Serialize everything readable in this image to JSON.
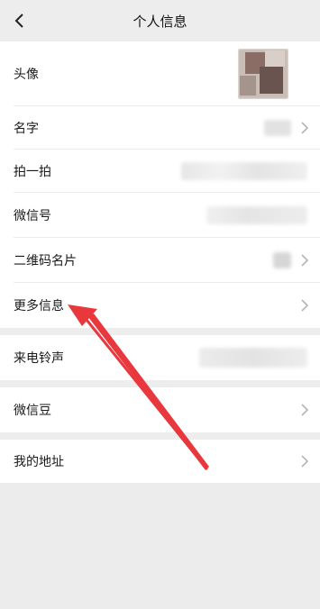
{
  "header": {
    "title": "个人信息",
    "back_icon": "chevron-left-icon"
  },
  "profile_rows": [
    {
      "label": "头像"
    },
    {
      "label": "名字"
    },
    {
      "label": "拍一拍"
    },
    {
      "label": "微信号"
    },
    {
      "label": "二维码名片"
    },
    {
      "label": "更多信息"
    }
  ],
  "ringtone_row": {
    "label": "来电铃声"
  },
  "beans_row": {
    "label": "微信豆"
  },
  "address_row": {
    "label": "我的地址"
  },
  "colors": {
    "annotation_arrow": "#e8383d",
    "background": "#ededed",
    "row_bg": "#ffffff"
  }
}
